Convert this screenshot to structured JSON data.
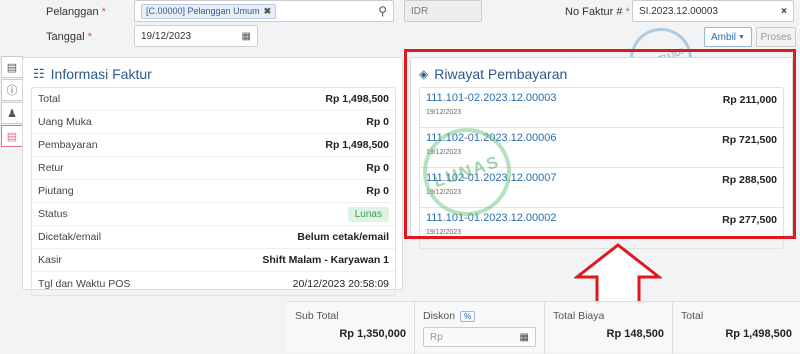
{
  "form": {
    "pelanggan_label": "Pelanggan",
    "pelanggan_value": "[C.00000] Pelanggan Umum",
    "currency": "IDR",
    "nofaktur_label": "No Faktur #",
    "nofaktur_value": "SI.2023.12.00003",
    "tanggal_label": "Tanggal",
    "tanggal_value": "19/12/2023",
    "ambil_label": "Ambil",
    "proses_label": "Proses",
    "required_mark": "*",
    "stamp_text": "DISETUJUI"
  },
  "info": {
    "title": "Informasi Faktur",
    "rows": [
      {
        "label": "Total",
        "value": "Rp 1,498,500"
      },
      {
        "label": "Uang Muka",
        "value": "Rp 0"
      },
      {
        "label": "Pembayaran",
        "value": "Rp 1,498,500"
      },
      {
        "label": "Retur",
        "value": "Rp 0"
      },
      {
        "label": "Piutang",
        "value": "Rp 0"
      },
      {
        "label": "Status",
        "value": "Lunas"
      },
      {
        "label": "Dicetak/email",
        "value": "Belum cetak/email"
      },
      {
        "label": "Kasir",
        "value": "Shift Malam - Karyawan 1"
      },
      {
        "label": "Tgl dan Waktu POS",
        "value": "20/12/2023 20:58:09"
      }
    ]
  },
  "riwayat": {
    "title": "Riwayat Pembayaran",
    "stamp_text": "LUNAS",
    "items": [
      {
        "code": "111.101-02.2023.12.00003",
        "date": "19/12/2023",
        "amount": "Rp 211,000"
      },
      {
        "code": "111.102-01.2023.12.00006",
        "date": "19/12/2023",
        "amount": "Rp 721,500"
      },
      {
        "code": "111.102-01.2023.12.00007",
        "date": "19/12/2023",
        "amount": "Rp 288,500"
      },
      {
        "code": "111.101-01.2023.12.00002",
        "date": "19/12/2023",
        "amount": "Rp 277,500"
      }
    ]
  },
  "summary": {
    "subtotal_label": "Sub Total",
    "subtotal_value": "Rp 1,350,000",
    "diskon_label": "Diskon",
    "diskon_toggle": "%",
    "diskon_placeholder": "Rp",
    "biaya_label": "Total Biaya",
    "biaya_value": "Rp 148,500",
    "total_label": "Total",
    "total_value": "Rp 1,498,500"
  },
  "colors": {
    "highlight": "#e0191f",
    "link": "#2b6cb0",
    "lunas": "#3c9a57"
  }
}
